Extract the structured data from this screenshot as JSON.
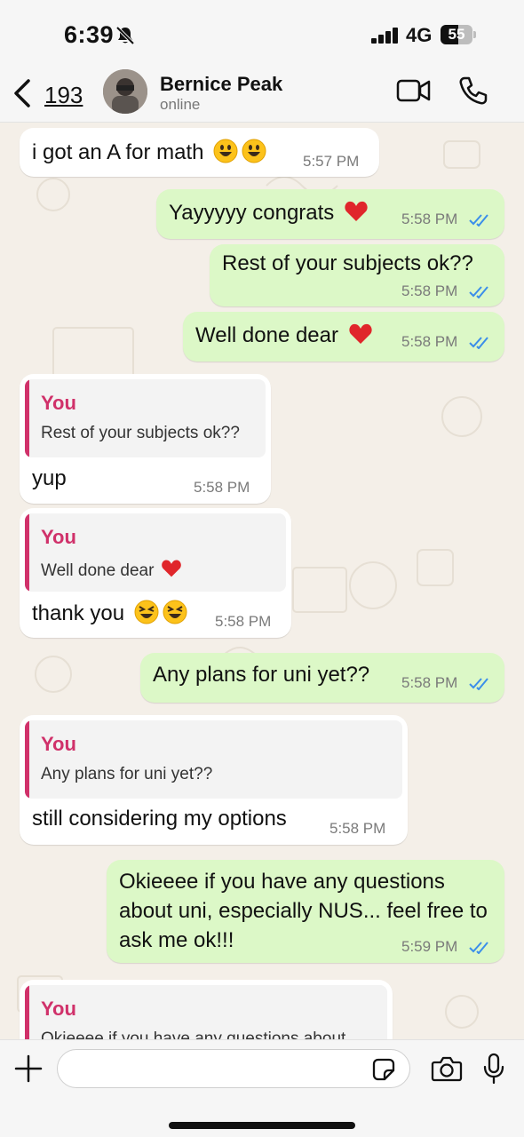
{
  "status_bar": {
    "time": "6:39",
    "network": "4G",
    "battery": "55"
  },
  "header": {
    "back_count": "193",
    "contact_name": "Bernice Peak",
    "contact_status": "online"
  },
  "colors": {
    "outgoing_bubble": "#dcf8c7",
    "incoming_bubble": "#ffffff",
    "quote_accent": "#d0316a",
    "read_ticks": "#3b8eea",
    "chat_background": "#f4efe8"
  },
  "messages": [
    {
      "direction": "incoming",
      "text": "i got an A for math",
      "emoji": "smiling-face-icons-x2",
      "time": "5:57 PM"
    },
    {
      "direction": "outgoing",
      "text": "Yayyyyy congrats",
      "emoji": "red-heart-icon",
      "time": "5:58 PM",
      "status": "read"
    },
    {
      "direction": "outgoing",
      "text": "Rest of your subjects ok??",
      "time": "5:58 PM",
      "status": "read"
    },
    {
      "direction": "outgoing",
      "text": "Well done dear",
      "emoji": "red-heart-icon",
      "time": "5:58 PM",
      "status": "read"
    },
    {
      "direction": "incoming",
      "reply_to": {
        "author": "You",
        "text": "Rest of your subjects ok??"
      },
      "text": "yup",
      "time": "5:58 PM"
    },
    {
      "direction": "incoming",
      "reply_to": {
        "author": "You",
        "text": "Well done dear"
      },
      "text": "thank you",
      "emoji": "laughing-face-icons-x2",
      "time": "5:58 PM"
    },
    {
      "direction": "outgoing",
      "text": "Any plans for uni yet??",
      "time": "5:58 PM",
      "status": "read"
    },
    {
      "direction": "incoming",
      "reply_to": {
        "author": "You",
        "text": "Any plans for uni yet??"
      },
      "text": "still considering my options",
      "time": "5:58 PM"
    },
    {
      "direction": "outgoing",
      "text": "Okieeee if you have any questions about uni, especially NUS... feel free to ask me ok!!!",
      "time": "5:59 PM",
      "status": "read"
    },
    {
      "direction": "incoming",
      "reply_to": {
        "author": "You",
        "text": "Okieeee if you have any questions about"
      }
    }
  ],
  "input": {
    "placeholder": ""
  }
}
